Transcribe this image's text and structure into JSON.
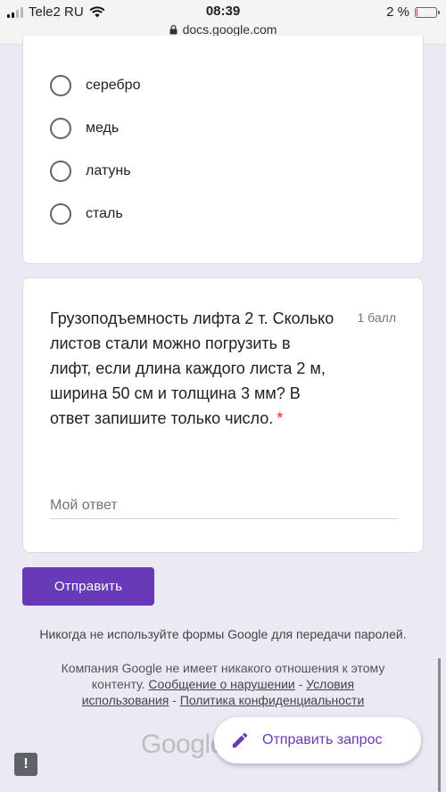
{
  "statusbar": {
    "carrier": "Tele2 RU",
    "time": "08:39",
    "url": "docs.google.com",
    "battery": "2 %"
  },
  "question_options": [
    {
      "label": "серебро"
    },
    {
      "label": "медь"
    },
    {
      "label": "латунь"
    },
    {
      "label": "сталь"
    }
  ],
  "question": {
    "text": "Грузоподъемность лифта 2 т. Сколько листов стали можно погрузить в лифт, если длина каждого листа 2 м, ширина 50 см и толщина 3 мм? В ответ запишите только число.",
    "required_mark": "*",
    "points": "1 балл",
    "answer_placeholder": "Мой ответ"
  },
  "form": {
    "submit_label": "Отправить",
    "password_note": "Никогда не используйте формы Google для передачи паролей.",
    "disclaimer_text": "Компания Google не имеет никакого отношения к этому контенту.",
    "link_abuse": "Сообщение о нарушении",
    "sep1": " - ",
    "link_terms": "Условия использования",
    "sep2": " - ",
    "link_privacy": "Политика конфиденциальности",
    "logo_text": "Google"
  },
  "feedback": {
    "label": "Отправить запрос"
  },
  "report": {
    "label": "!"
  },
  "colors": {
    "accent": "#673ab7",
    "background": "#ece8f4",
    "required": "#d93025"
  }
}
